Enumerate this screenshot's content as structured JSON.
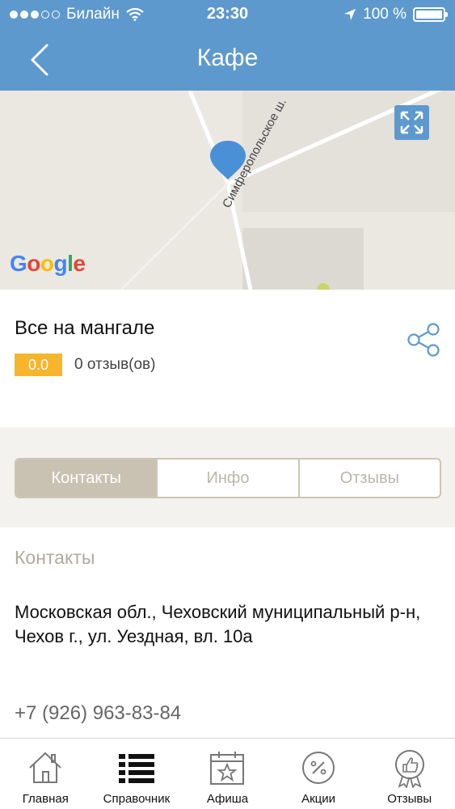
{
  "status_bar": {
    "carrier": "Билайн",
    "time": "23:30",
    "battery": "100 %"
  },
  "header": {
    "title": "Кафе",
    "back_icon": "chevron-left-icon"
  },
  "map": {
    "street_label": "Симферопольское ш.",
    "provider_logo": "Google",
    "expand_icon": "expand-icon",
    "marker_color": "#4a90d6"
  },
  "place": {
    "name": "Все на мангале",
    "rating": "0.0",
    "reviews": "0 отзыв(ов)",
    "share_icon": "share-icon"
  },
  "tabs": [
    {
      "label": "Контакты",
      "active": true
    },
    {
      "label": "Инфо",
      "active": false
    },
    {
      "label": "Отзывы",
      "active": false
    }
  ],
  "contacts": {
    "title": "Контакты",
    "address": "Московская обл., Чеховский муниципальный р-н, Чехов г., ул. Уездная, вл. 10а",
    "phone": "+7 (926) 963-83-84"
  },
  "bottom_nav": [
    {
      "label": "Главная",
      "icon": "home-icon"
    },
    {
      "label": "Справочник",
      "icon": "list-icon"
    },
    {
      "label": "Афиша",
      "icon": "calendar-star-icon"
    },
    {
      "label": "Акции",
      "icon": "percent-icon"
    },
    {
      "label": "Отзывы",
      "icon": "thumbs-up-badge-icon"
    }
  ],
  "colors": {
    "accent": "#5e99cd",
    "rating": "#f6b52c",
    "tab_active": "#c9c1b2"
  }
}
